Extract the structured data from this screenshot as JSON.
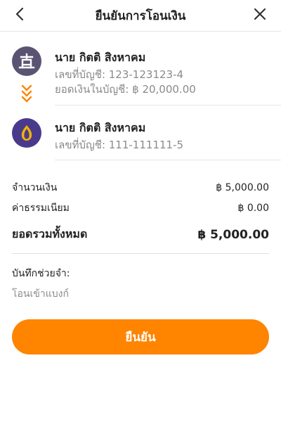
{
  "header": {
    "title": "ยืนยันการโอนเงิน",
    "back_icon": "chevron-left-icon",
    "close_icon": "close-icon"
  },
  "from_account": {
    "bank_icon": "krungthai-bank-icon",
    "bank_color": "#5a5472",
    "name": "นาย กิตติ สิงหาคม",
    "account_line": "เลขที่บัญชี: 123-123123-4",
    "balance_line": "ยอดเงินในบัญชี: ฿ 20,000.00"
  },
  "transfer_arrow_icon": "double-chevron-down-icon",
  "to_account": {
    "bank_icon": "scb-bank-icon",
    "bank_color": "#4a3a8c",
    "name": "นาย กิตติ สิงหาคม",
    "account_line": "เลขที่บัญชี: 111-111111-5"
  },
  "summary": {
    "amount_label": "จำนวนเงิน",
    "amount_value": "฿ 5,000.00",
    "fee_label": "ค่าธรรมเนียม",
    "fee_value": "฿ 0.00",
    "total_label": "ยอดรวมทั้งหมด",
    "total_value": "฿ 5,000.00"
  },
  "memo": {
    "label": "บันทึกช่วยจำ:",
    "value": "",
    "placeholder": "โอนเข้าแบงก์"
  },
  "confirm_button": {
    "label": "ยืนยัน",
    "color": "#ff8400"
  },
  "accent_color": "#ff8400"
}
